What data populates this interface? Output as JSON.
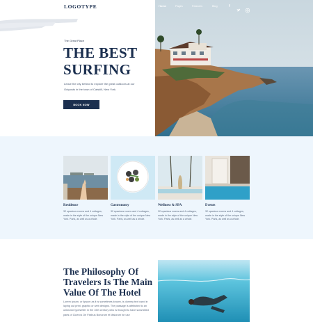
{
  "header": {
    "logo": "LOGOTYPE",
    "nav": [
      {
        "label": "Home"
      },
      {
        "label": "Pages"
      },
      {
        "label": "Features"
      },
      {
        "label": "Blog"
      }
    ],
    "social_icons": [
      "facebook-icon",
      "twitter-icon",
      "instagram-icon"
    ]
  },
  "hero": {
    "kicker": "The Great Place",
    "title_line1": "THE BEST",
    "title_line2": "SURFING",
    "description": "Leave the city behind to explore the great outdoors at our Outposts in the town of Catskill, New York.",
    "button": "BOOK NOW"
  },
  "features": [
    {
      "title": "Residence",
      "text": "32 spacious rooms and 4 cottages, made in the style of the unique New York. Paris, as well as a whole."
    },
    {
      "title": "Gastronomy",
      "text": "32 spacious rooms and 4 cottages, made in the style of the unique New York. Paris, as well as a whole."
    },
    {
      "title": "Wellness & SPA",
      "text": "32 spacious rooms and 4 cottages, made in the style of the unique New York. Paris, as well as a whole."
    },
    {
      "title": "Events",
      "text": "32 spacious rooms and 4 cottages, made in the style of the unique New York. Paris, as well as a whole."
    }
  ],
  "philosophy": {
    "title": "The Philosophy Of Travelers Is The Main Value Of The Hotel",
    "text": "Lorem ipsum, or lipsum as it is sometimes known, is dummy text used in laying out print, graphic or web designs. The passage is attributed to an unknown typesetter in the 15th century who is thought to have scrambled parts of Cicero's De Finibus Bonorum et Malorum for use"
  },
  "colors": {
    "navy": "#1b2f4f",
    "light_blue": "#eef6fd"
  }
}
